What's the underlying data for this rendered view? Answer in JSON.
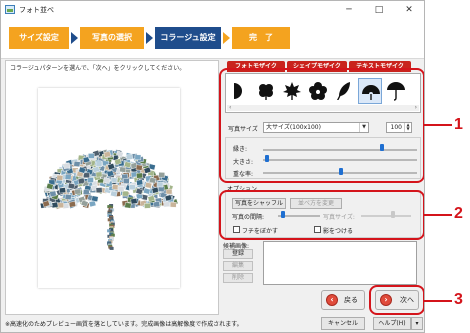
{
  "window": {
    "title": "フォト並べ"
  },
  "steps": [
    "サイズ設定",
    "写真の選択",
    "コラージュ設定",
    "完　了"
  ],
  "left": {
    "instruction": "コラージュパターンを選んで、「次へ」をクリックしてください。"
  },
  "tabs": [
    "フォトモザイク",
    "シェイプモザイク",
    "テキストモザイク"
  ],
  "shapes": [
    "half-circle-icon",
    "clover-icon",
    "maple-leaf-icon",
    "flower-icon",
    "feather-icon",
    "folding-fan-icon",
    "umbrella-icon"
  ],
  "photo_size": {
    "label": "写真サイズ",
    "value": "大サイズ(100x100)",
    "number": "100"
  },
  "sliders": {
    "rim": "縁き:",
    "size": "大きさ:",
    "overlap": "重な率:"
  },
  "options": {
    "title": "オプション",
    "shuffle": "写真をシャッフル",
    "order": "並べ方を変更",
    "spacing": "写真の間隔:",
    "photo_size": "写真サイズ:",
    "blur_edge": "フチをぼかす",
    "shadow": "影をつける"
  },
  "candidates": {
    "title": "候補画像:",
    "register": "登録",
    "edit": "編集",
    "delete": "削除"
  },
  "nav": {
    "back": "戻る",
    "next": "次へ"
  },
  "status": "※高速化のためプレビュー画質を落としています。完成画像は高解像度で作成されます。",
  "footer": {
    "cancel": "キャンセル",
    "help": "ヘルプ(H)"
  },
  "callouts": [
    "1",
    "2",
    "3"
  ],
  "colors": {
    "step_orange": "#f4a31f",
    "step_active": "#1f4d8c",
    "tab_red": "#c9231d",
    "callout_red": "#d4141b"
  }
}
